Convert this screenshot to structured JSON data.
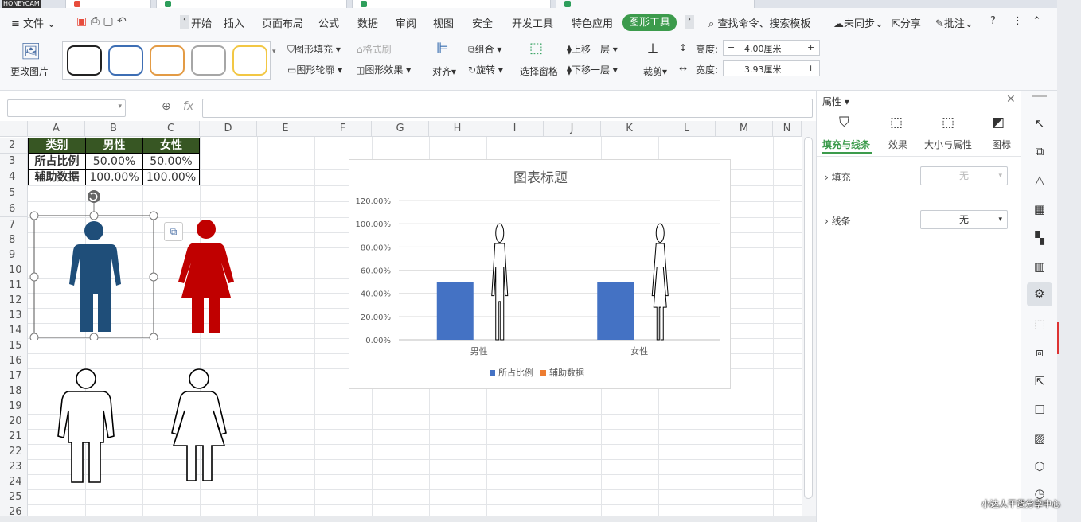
{
  "watermark_top": "HONEYCAM",
  "menubar": {
    "file": "文件",
    "tabs": [
      "开始",
      "插入",
      "页面布局",
      "公式",
      "数据",
      "审阅",
      "视图",
      "安全",
      "开发工具",
      "特色应用",
      "图形工具"
    ],
    "search": "查找命令、搜索模板",
    "unsync": "未同步",
    "share": "分享",
    "annotate": "批注"
  },
  "ribbon": {
    "change_picture": "更改图片",
    "shape_fill": "图形填充",
    "format_brush": "格式刷",
    "shape_outline": "图形轮廓",
    "shape_effect": "图形效果",
    "align": "对齐",
    "group": "组合",
    "rotate": "旋转",
    "select_pane": "选择窗格",
    "bring_forward": "上移一层",
    "send_backward": "下移一层",
    "crop": "裁剪",
    "height_label": "高度:",
    "height_value": "4.00厘米",
    "width_label": "宽度:",
    "width_value": "3.93厘米",
    "minus": "−",
    "plus": "+",
    "style_colors": [
      "#222222",
      "#3d6eb4",
      "#e39b45",
      "#a6a6a6",
      "#f2c744"
    ]
  },
  "formula_bar": {
    "fx": "fx"
  },
  "sheet": {
    "columns": [
      "A",
      "B",
      "C",
      "D",
      "E",
      "F",
      "G",
      "H",
      "I",
      "J",
      "K",
      "L",
      "M",
      "N"
    ],
    "rows": [
      "2",
      "3",
      "4",
      "5",
      "6",
      "7",
      "8",
      "9",
      "10",
      "11",
      "12",
      "13",
      "14",
      "15",
      "16",
      "17",
      "18",
      "19",
      "20",
      "21",
      "22",
      "23",
      "24",
      "25",
      "26"
    ],
    "table": {
      "header": [
        "类别",
        "男性",
        "女性"
      ],
      "row1": [
        "所占比例",
        "50.00%",
        "50.00%"
      ],
      "row2": [
        "辅助数据",
        "100.00%",
        "100.00%"
      ]
    }
  },
  "chart_data": {
    "type": "bar",
    "title": "图表标题",
    "categories": [
      "男性",
      "女性"
    ],
    "series": [
      {
        "name": "所占比例",
        "values": [
          0.5,
          0.5
        ],
        "color": "#4472c4"
      },
      {
        "name": "辅助数据",
        "values": [
          1.0,
          1.0
        ],
        "color": "#ed7d31"
      }
    ],
    "y_ticks": [
      "0.00%",
      "20.00%",
      "40.00%",
      "60.00%",
      "80.00%",
      "100.00%",
      "120.00%"
    ],
    "ylim": [
      0,
      1.2
    ],
    "grid": true,
    "legend": "bottom"
  },
  "panel": {
    "title": "属性",
    "tabs": [
      "填充与线条",
      "效果",
      "大小与属性",
      "图标"
    ],
    "fill_label": "填充",
    "fill_value": "无",
    "line_label": "线条",
    "line_value": "无"
  },
  "watermark_bottom": "小达人干货分享中心",
  "colors": {
    "male_blue": "#1f4e79",
    "female_red": "#c00000",
    "header_green": "#375623",
    "accent_green": "#3c9b4c"
  }
}
